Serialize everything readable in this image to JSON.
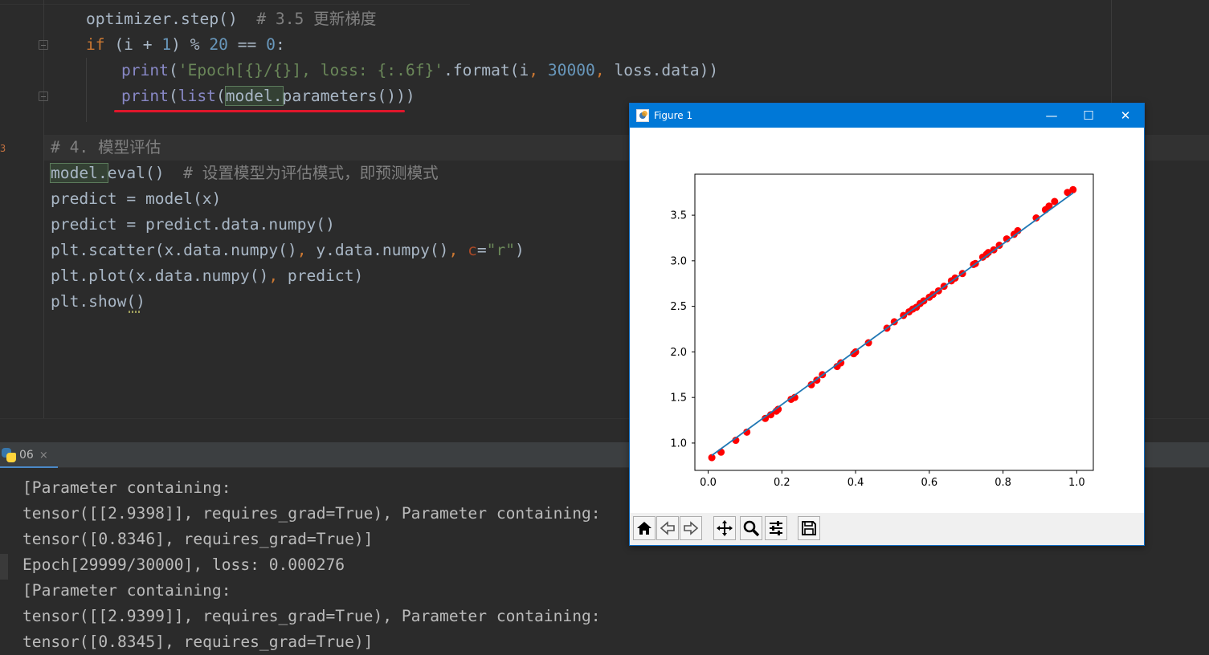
{
  "editor": {
    "lines": {
      "l1_code": "optimizer.step()  ",
      "l1_comment": "# 3.5 更新梯度",
      "l2_kw": "if",
      "l2_a": " (i + ",
      "l2_num1": "1",
      "l2_b": ") % ",
      "l2_num2": "20",
      "l2_c": " == ",
      "l2_num3": "0",
      "l2_d": ":",
      "l3_fn": "print",
      "l3_a": "(",
      "l3_str": "'Epoch[{}/{}], loss: {:.6f}'",
      "l3_b": ".format(i",
      "l3_comma1": ", ",
      "l3_num": "30000",
      "l3_comma2": ", ",
      "l3_c": "loss.data))",
      "l4_fn1": "print",
      "l4_a": "(",
      "l4_fn2": "list",
      "l4_b": "(",
      "l4_hl": "model.",
      "l4_c": "parameters()))",
      "l6_comment": "# 4. 模型评估",
      "l7_hl": "model.",
      "l7_a": "eval()  ",
      "l7_comment": "# 设置模型为评估模式，即预测模式",
      "l8": "predict = model(x)",
      "l9": "predict = predict.data.numpy()",
      "l10_a": "plt.scatter(x.data.numpy()",
      "l10_comma1": ", ",
      "l10_b": "y.data.numpy()",
      "l10_comma2": ", ",
      "l10_param": "c",
      "l10_eq": "=",
      "l10_str": "\"r\"",
      "l10_c": ")",
      "l11_a": "plt.plot(x.data.numpy()",
      "l11_comma": ", ",
      "l11_b": "predict)",
      "l12_a": "plt.show(",
      "l12_b": ")"
    },
    "left_marker": "3"
  },
  "run_panel": {
    "tab_label": "06",
    "tab_close": "×",
    "console": [
      "[Parameter containing:",
      "tensor([[2.9398]], requires_grad=True), Parameter containing:",
      "tensor([0.8346], requires_grad=True)]",
      "Epoch[29999/30000], loss: 0.000276",
      "[Parameter containing:",
      "tensor([[2.9399]], requires_grad=True), Parameter containing:",
      "tensor([0.8345], requires_grad=True)]"
    ]
  },
  "figure": {
    "title": "Figure 1",
    "minimize": "—",
    "maximize": "☐",
    "close": "✕",
    "toolbar": [
      "home-icon",
      "back-icon",
      "forward-icon",
      "pan-icon",
      "zoom-icon",
      "configure-icon",
      "save-icon"
    ]
  },
  "colors": {
    "scatter": "#ff0000",
    "line": "#1f77b4",
    "titlebar": "#0078d7",
    "underline": "#e0162b"
  },
  "chart_data": {
    "type": "scatter",
    "x_ticks": [
      0.0,
      0.2,
      0.4,
      0.6,
      0.8,
      1.0
    ],
    "x_tick_labels": [
      "0.0",
      "0.2",
      "0.4",
      "0.6",
      "0.8",
      "1.0"
    ],
    "y_ticks": [
      1.0,
      1.5,
      2.0,
      2.5,
      3.0,
      3.5
    ],
    "y_tick_labels": [
      "1.0",
      "1.5",
      "2.0",
      "2.5",
      "3.0",
      "3.5"
    ],
    "xlim": [
      -0.036,
      1.045
    ],
    "ylim": [
      0.7,
      3.95
    ],
    "grid": false,
    "series": [
      {
        "type": "scatter",
        "color": "#ff0000",
        "x": [
          0.01,
          0.035,
          0.075,
          0.105,
          0.155,
          0.17,
          0.185,
          0.19,
          0.225,
          0.235,
          0.28,
          0.295,
          0.31,
          0.35,
          0.36,
          0.395,
          0.4,
          0.435,
          0.485,
          0.505,
          0.53,
          0.545,
          0.555,
          0.565,
          0.575,
          0.585,
          0.6,
          0.61,
          0.625,
          0.64,
          0.66,
          0.67,
          0.69,
          0.72,
          0.725,
          0.745,
          0.755,
          0.76,
          0.775,
          0.79,
          0.81,
          0.83,
          0.84,
          0.89,
          0.915,
          0.925,
          0.94,
          0.975,
          0.99
        ],
        "y": [
          0.84,
          0.9,
          1.03,
          1.12,
          1.27,
          1.31,
          1.35,
          1.37,
          1.48,
          1.5,
          1.64,
          1.69,
          1.75,
          1.84,
          1.88,
          1.98,
          2.0,
          2.1,
          2.26,
          2.33,
          2.4,
          2.44,
          2.47,
          2.49,
          2.53,
          2.56,
          2.6,
          2.63,
          2.67,
          2.72,
          2.78,
          2.81,
          2.86,
          2.96,
          2.97,
          3.04,
          3.07,
          3.09,
          3.12,
          3.17,
          3.24,
          3.29,
          3.33,
          3.47,
          3.56,
          3.6,
          3.65,
          3.75,
          3.78
        ]
      },
      {
        "type": "line",
        "color": "#1f77b4",
        "x": [
          0.01,
          0.99
        ],
        "y": [
          0.864,
          3.744
        ]
      }
    ]
  }
}
